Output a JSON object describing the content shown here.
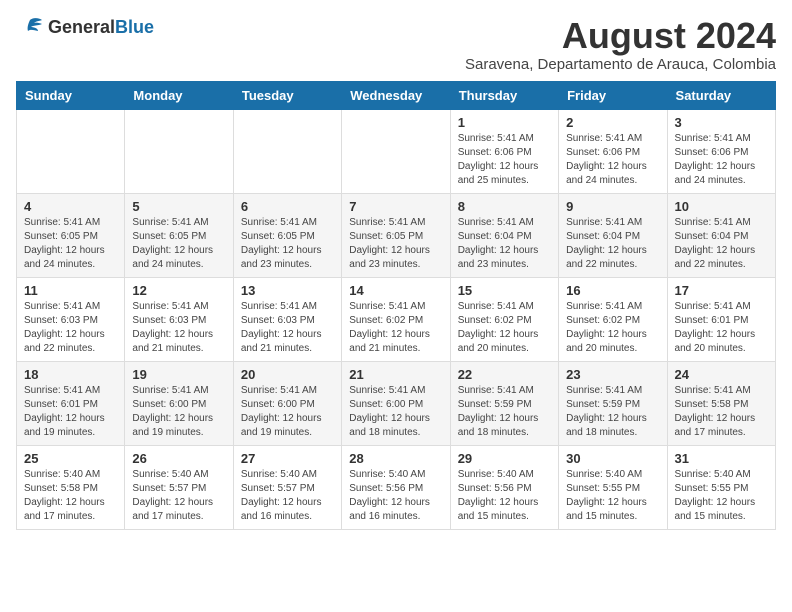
{
  "header": {
    "logo_general": "General",
    "logo_blue": "Blue",
    "month_year": "August 2024",
    "location": "Saravena, Departamento de Arauca, Colombia"
  },
  "calendar": {
    "days_of_week": [
      "Sunday",
      "Monday",
      "Tuesday",
      "Wednesday",
      "Thursday",
      "Friday",
      "Saturday"
    ],
    "weeks": [
      [
        {
          "day": "",
          "info": ""
        },
        {
          "day": "",
          "info": ""
        },
        {
          "day": "",
          "info": ""
        },
        {
          "day": "",
          "info": ""
        },
        {
          "day": "1",
          "info": "Sunrise: 5:41 AM\nSunset: 6:06 PM\nDaylight: 12 hours\nand 25 minutes."
        },
        {
          "day": "2",
          "info": "Sunrise: 5:41 AM\nSunset: 6:06 PM\nDaylight: 12 hours\nand 24 minutes."
        },
        {
          "day": "3",
          "info": "Sunrise: 5:41 AM\nSunset: 6:06 PM\nDaylight: 12 hours\nand 24 minutes."
        }
      ],
      [
        {
          "day": "4",
          "info": "Sunrise: 5:41 AM\nSunset: 6:05 PM\nDaylight: 12 hours\nand 24 minutes."
        },
        {
          "day": "5",
          "info": "Sunrise: 5:41 AM\nSunset: 6:05 PM\nDaylight: 12 hours\nand 24 minutes."
        },
        {
          "day": "6",
          "info": "Sunrise: 5:41 AM\nSunset: 6:05 PM\nDaylight: 12 hours\nand 23 minutes."
        },
        {
          "day": "7",
          "info": "Sunrise: 5:41 AM\nSunset: 6:05 PM\nDaylight: 12 hours\nand 23 minutes."
        },
        {
          "day": "8",
          "info": "Sunrise: 5:41 AM\nSunset: 6:04 PM\nDaylight: 12 hours\nand 23 minutes."
        },
        {
          "day": "9",
          "info": "Sunrise: 5:41 AM\nSunset: 6:04 PM\nDaylight: 12 hours\nand 22 minutes."
        },
        {
          "day": "10",
          "info": "Sunrise: 5:41 AM\nSunset: 6:04 PM\nDaylight: 12 hours\nand 22 minutes."
        }
      ],
      [
        {
          "day": "11",
          "info": "Sunrise: 5:41 AM\nSunset: 6:03 PM\nDaylight: 12 hours\nand 22 minutes."
        },
        {
          "day": "12",
          "info": "Sunrise: 5:41 AM\nSunset: 6:03 PM\nDaylight: 12 hours\nand 21 minutes."
        },
        {
          "day": "13",
          "info": "Sunrise: 5:41 AM\nSunset: 6:03 PM\nDaylight: 12 hours\nand 21 minutes."
        },
        {
          "day": "14",
          "info": "Sunrise: 5:41 AM\nSunset: 6:02 PM\nDaylight: 12 hours\nand 21 minutes."
        },
        {
          "day": "15",
          "info": "Sunrise: 5:41 AM\nSunset: 6:02 PM\nDaylight: 12 hours\nand 20 minutes."
        },
        {
          "day": "16",
          "info": "Sunrise: 5:41 AM\nSunset: 6:02 PM\nDaylight: 12 hours\nand 20 minutes."
        },
        {
          "day": "17",
          "info": "Sunrise: 5:41 AM\nSunset: 6:01 PM\nDaylight: 12 hours\nand 20 minutes."
        }
      ],
      [
        {
          "day": "18",
          "info": "Sunrise: 5:41 AM\nSunset: 6:01 PM\nDaylight: 12 hours\nand 19 minutes."
        },
        {
          "day": "19",
          "info": "Sunrise: 5:41 AM\nSunset: 6:00 PM\nDaylight: 12 hours\nand 19 minutes."
        },
        {
          "day": "20",
          "info": "Sunrise: 5:41 AM\nSunset: 6:00 PM\nDaylight: 12 hours\nand 19 minutes."
        },
        {
          "day": "21",
          "info": "Sunrise: 5:41 AM\nSunset: 6:00 PM\nDaylight: 12 hours\nand 18 minutes."
        },
        {
          "day": "22",
          "info": "Sunrise: 5:41 AM\nSunset: 5:59 PM\nDaylight: 12 hours\nand 18 minutes."
        },
        {
          "day": "23",
          "info": "Sunrise: 5:41 AM\nSunset: 5:59 PM\nDaylight: 12 hours\nand 18 minutes."
        },
        {
          "day": "24",
          "info": "Sunrise: 5:41 AM\nSunset: 5:58 PM\nDaylight: 12 hours\nand 17 minutes."
        }
      ],
      [
        {
          "day": "25",
          "info": "Sunrise: 5:40 AM\nSunset: 5:58 PM\nDaylight: 12 hours\nand 17 minutes."
        },
        {
          "day": "26",
          "info": "Sunrise: 5:40 AM\nSunset: 5:57 PM\nDaylight: 12 hours\nand 17 minutes."
        },
        {
          "day": "27",
          "info": "Sunrise: 5:40 AM\nSunset: 5:57 PM\nDaylight: 12 hours\nand 16 minutes."
        },
        {
          "day": "28",
          "info": "Sunrise: 5:40 AM\nSunset: 5:56 PM\nDaylight: 12 hours\nand 16 minutes."
        },
        {
          "day": "29",
          "info": "Sunrise: 5:40 AM\nSunset: 5:56 PM\nDaylight: 12 hours\nand 15 minutes."
        },
        {
          "day": "30",
          "info": "Sunrise: 5:40 AM\nSunset: 5:55 PM\nDaylight: 12 hours\nand 15 minutes."
        },
        {
          "day": "31",
          "info": "Sunrise: 5:40 AM\nSunset: 5:55 PM\nDaylight: 12 hours\nand 15 minutes."
        }
      ]
    ]
  }
}
